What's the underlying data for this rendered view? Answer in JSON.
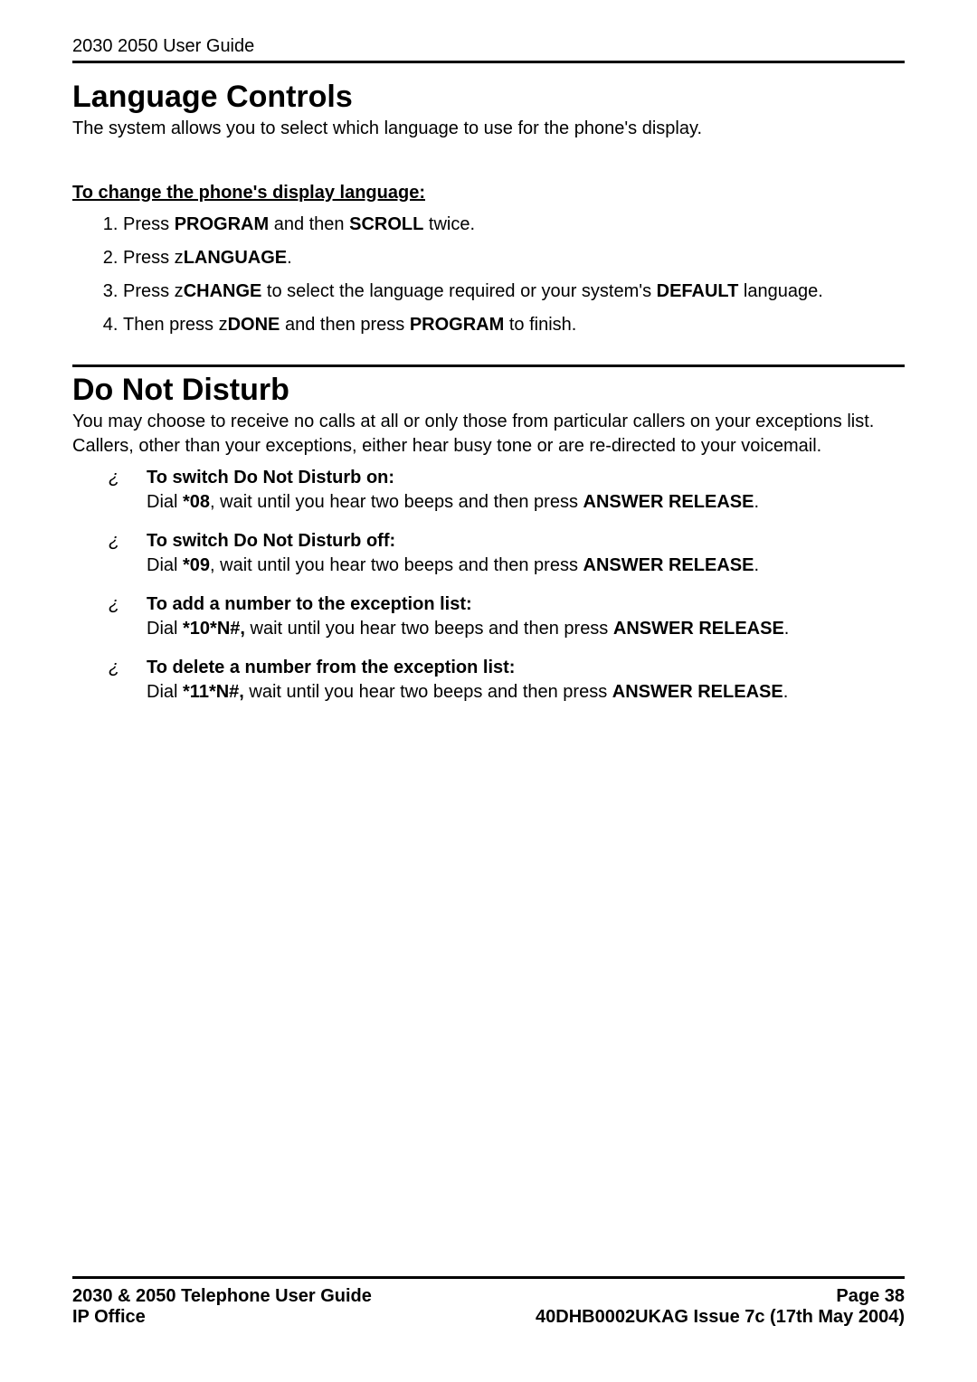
{
  "header": {
    "running_head": "2030 2050 User Guide"
  },
  "section1": {
    "title": "Language Controls",
    "intro": "The system allows you to select which language to use for the phone's display.",
    "sub_heading": "To change the phone's display language:",
    "steps": [
      {
        "pre": "Press ",
        "b1": "PROGRAM",
        "mid": " and then ",
        "b2": "SCROLL",
        "post": " twice."
      },
      {
        "pre": "Press  z",
        "b1": "LANGUAGE",
        "post": "."
      },
      {
        "pre": "Press  z",
        "b1": "CHANGE",
        "mid": " to select the language required or your system's ",
        "b2": "DEFAULT",
        "post": " language."
      },
      {
        "pre": "Then press  z",
        "b1": "DONE",
        "mid": " and then press ",
        "b2": "PROGRAM",
        "post": " to finish."
      }
    ]
  },
  "section2": {
    "title": "Do Not Disturb",
    "intro": "You may choose to receive no calls at all or only those from particular callers on your exceptions list. Callers, other than your exceptions, either hear busy tone or are re-directed to your voicemail.",
    "items": [
      {
        "heading": "To switch Do Not Disturb on:",
        "pre": "Dial ",
        "code": "*08",
        "mid": ", wait until you hear two beeps and then press ",
        "btn": "ANSWER RELEASE",
        "post": "."
      },
      {
        "heading": "To switch Do Not Disturb off:",
        "pre": "Dial ",
        "code": "*09",
        "mid": ", wait until you hear two beeps and then press ",
        "btn": "ANSWER RELEASE",
        "post": "."
      },
      {
        "heading": "To add a number to the exception list:",
        "pre": "Dial ",
        "code": "*10*N#,",
        "mid": " wait until you hear two beeps and then press ",
        "btn": "ANSWER RELEASE",
        "post": "."
      },
      {
        "heading": "To delete a number from the exception list:",
        "pre": "Dial ",
        "code": "*11*N#,",
        "mid": " wait until you hear two beeps and then press ",
        "btn": "ANSWER RELEASE",
        "post": "."
      }
    ]
  },
  "footer": {
    "left1": "2030 & 2050 Telephone User Guide",
    "left2": "IP Office",
    "right1": "Page 38",
    "right2": "40DHB0002UKAG Issue 7c (17th May 2004)"
  }
}
